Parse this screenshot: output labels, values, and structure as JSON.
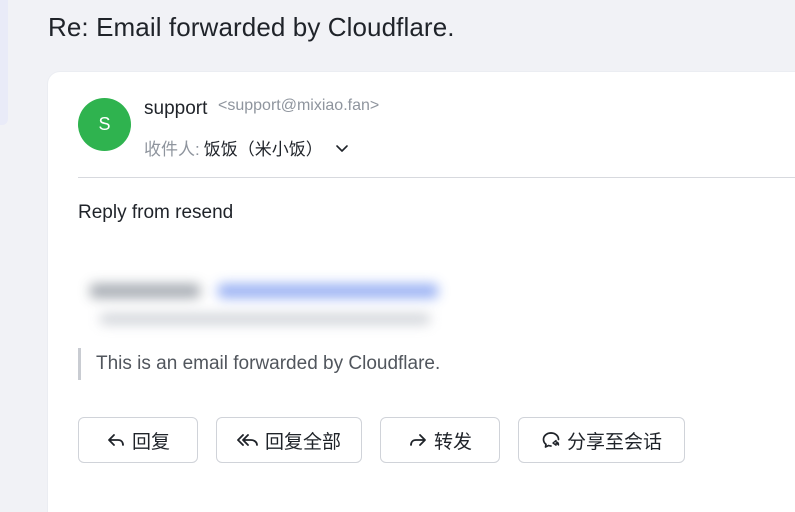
{
  "subject": "Re: Email forwarded by Cloudflare.",
  "sender": {
    "avatar_letter": "S",
    "avatar_color": "#2fb34f",
    "name": "support",
    "email": "<support@mixiao.fan>"
  },
  "recipients": {
    "label": "收件人:",
    "value": "饭饭（米小饭）"
  },
  "body": {
    "text": "Reply from resend",
    "quote": "This is an email forwarded by Cloudflare."
  },
  "actions": {
    "reply": "回复",
    "reply_all": "回复全部",
    "forward": "转发",
    "share": "分享至会话"
  },
  "icons": {
    "reply": "reply-icon",
    "reply_all": "reply-all-icon",
    "forward": "forward-icon",
    "share": "share-chat-icon",
    "expand": "chevron-down-icon"
  }
}
